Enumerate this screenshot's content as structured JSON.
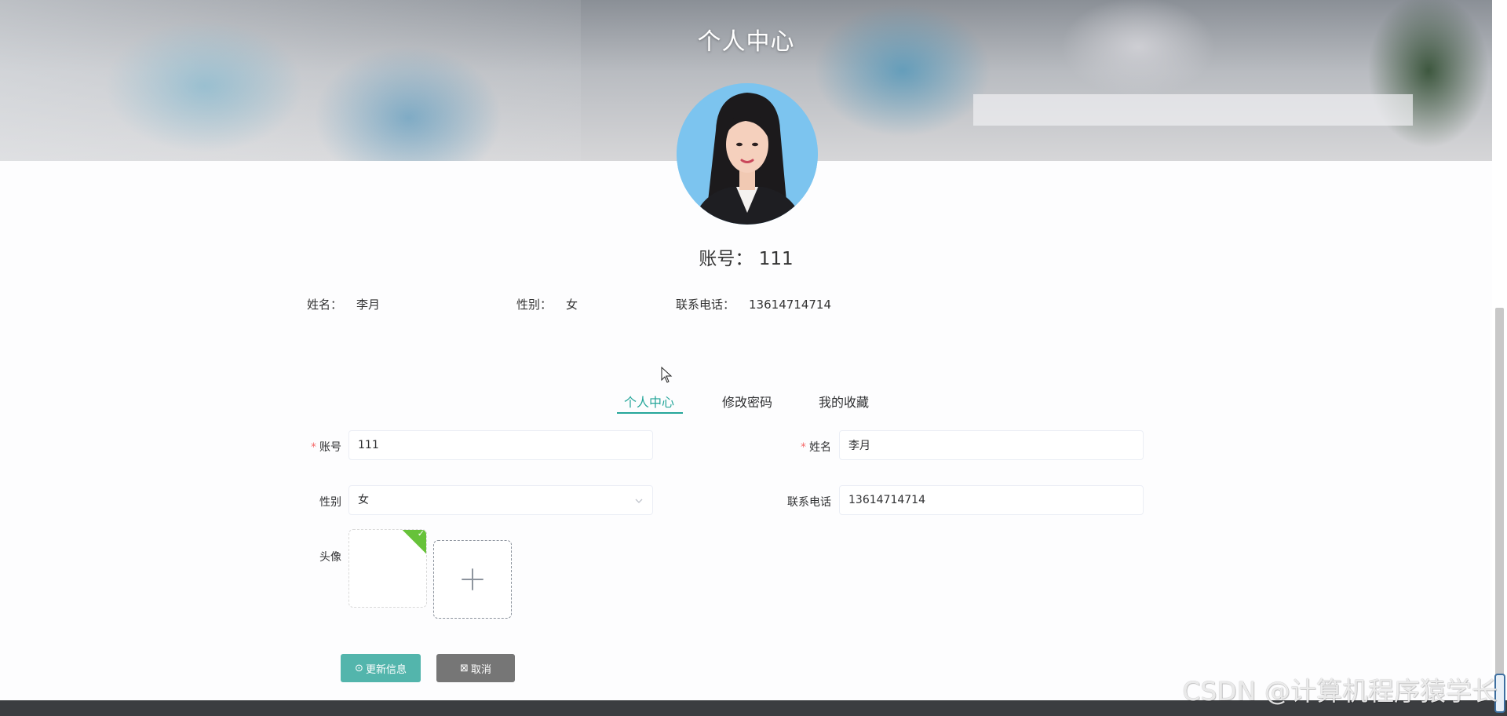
{
  "header": {
    "title": "个人中心"
  },
  "profile": {
    "account_label": "账号：",
    "account_value": "111",
    "name_label": "姓名：",
    "name_value": "李月",
    "gender_label": "性别：",
    "gender_value": "女",
    "phone_label": "联系电话：",
    "phone_value": "13614714714"
  },
  "tabs": [
    {
      "label": "个人中心",
      "active": true
    },
    {
      "label": "修改密码",
      "active": false
    },
    {
      "label": "我的收藏",
      "active": false
    }
  ],
  "form": {
    "account": {
      "label": "账号",
      "required": true,
      "value": "111"
    },
    "name": {
      "label": "姓名",
      "required": true,
      "value": "李月"
    },
    "gender": {
      "label": "性别",
      "value": "女"
    },
    "phone": {
      "label": "联系电话",
      "value": "13614714714"
    },
    "avatar": {
      "label": "头像"
    },
    "submit_label": "更新信息",
    "cancel_label": "取消"
  },
  "watermark": "CSDN @计算机程序猿学长",
  "colors": {
    "accent": "#26a69a",
    "primary_button": "#53b5ac",
    "cancel_button": "#767676",
    "required": "#f56c6c",
    "upload_success": "#67c23a"
  },
  "icons": {
    "submit": "circle-check-icon",
    "cancel": "square-x-icon",
    "upload": "plus-icon",
    "select": "chevron-down-icon"
  }
}
